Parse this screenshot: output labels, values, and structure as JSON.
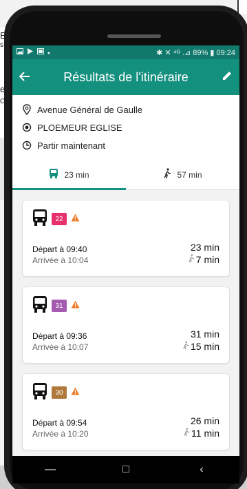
{
  "background": {
    "fragments": [
      "E",
      "s",
      "er",
      "C"
    ]
  },
  "statusbar": {
    "left_icons": [
      "image-icon",
      "play-icon",
      "gallery-icon",
      "dot-icon"
    ],
    "right_text": "✱ ✕ ⁴ᴳ .⊿ 89% ▮ 09:24"
  },
  "appbar": {
    "title": "Résultats de l'itinéraire",
    "back_icon": "arrow-back-icon",
    "edit_icon": "pencil-icon"
  },
  "route": {
    "from": "Avenue Général de Gaulle",
    "to": "PLOEMEUR EGLISE",
    "when": "Partir maintenant"
  },
  "tabs": [
    {
      "label": "23 min",
      "icon": "bus-icon",
      "active": true
    },
    {
      "label": "57 min",
      "icon": "walk-icon",
      "active": false
    }
  ],
  "results": [
    {
      "line": "22",
      "color": "#e8306c",
      "depart": "Départ à 09:40",
      "arrive": "Arrivée à 10:04",
      "duration": "23 min",
      "walk": "7 min"
    },
    {
      "line": "31",
      "color": "#a45bb0",
      "depart": "Départ à 09:36",
      "arrive": "Arrivée à 10:07",
      "duration": "31 min",
      "walk": "15 min"
    },
    {
      "line": "30",
      "color": "#b0793b",
      "depart": "Départ à 09:54",
      "arrive": "Arrivée à 10:20",
      "duration": "26 min",
      "walk": "11 min"
    }
  ],
  "colors": {
    "primary": "#14907f",
    "primary_dark": "#10796c",
    "warning": "#f08030"
  },
  "navbar": {
    "back": "‹",
    "home": "□",
    "recent": "—"
  }
}
